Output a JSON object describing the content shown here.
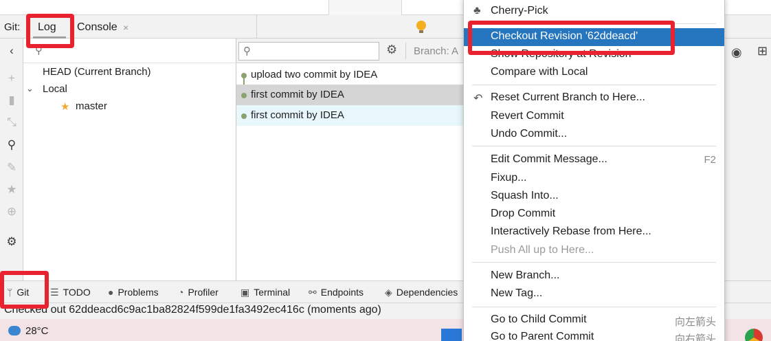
{
  "tool_window": {
    "label": "Git:",
    "tabs": [
      {
        "label": "Log",
        "active": true
      },
      {
        "label": "Console",
        "active": false
      }
    ],
    "close_glyph": "×"
  },
  "branches": {
    "head": "HEAD (Current Branch)",
    "local_label": "Local",
    "master": "master"
  },
  "log": {
    "branch_filter": "Branch: A",
    "commits": [
      {
        "message": "upload two commit by IDEA"
      },
      {
        "message": "first commit by IDEA"
      },
      {
        "message": "first commit by IDEA"
      }
    ]
  },
  "context_menu": {
    "items": [
      {
        "label": "Cherry-Pick",
        "icon": "cherry-icon"
      },
      {
        "label": "Checkout Revision '62ddeacd'",
        "highlighted": true
      },
      {
        "label": "Show Repository at Revision"
      },
      {
        "label": "Compare with Local"
      },
      {
        "label": "Reset Current Branch to Here...",
        "icon": "undo-icon"
      },
      {
        "label": "Revert Commit"
      },
      {
        "label": "Undo Commit..."
      },
      {
        "label": "Edit Commit Message...",
        "shortcut": "F2"
      },
      {
        "label": "Fixup..."
      },
      {
        "label": "Squash Into..."
      },
      {
        "label": "Drop Commit"
      },
      {
        "label": "Interactively Rebase from Here..."
      },
      {
        "label": "Push All up to Here...",
        "disabled": true
      },
      {
        "label": "New Branch..."
      },
      {
        "label": "New Tag..."
      },
      {
        "label": "Go to Child Commit",
        "shortcut": "向左箭头"
      },
      {
        "label": "Go to Parent Commit",
        "shortcut": "向右箭头"
      }
    ]
  },
  "bottom_toolbar": {
    "items": [
      {
        "label": "Git",
        "icon": "git-branch-icon"
      },
      {
        "label": "TODO",
        "icon": "list-icon"
      },
      {
        "label": "Problems",
        "icon": "info-icon"
      },
      {
        "label": "Profiler",
        "icon": "profiler-icon"
      },
      {
        "label": "Terminal",
        "icon": "terminal-icon"
      },
      {
        "label": "Endpoints",
        "icon": "endpoints-icon"
      },
      {
        "label": "Dependencies",
        "icon": "layers-icon"
      }
    ]
  },
  "status": {
    "message": "Checked out 62ddeacd6c9ac1ba82824f599de1fa3492ec416c (moments ago)"
  },
  "taskbar": {
    "temperature": "28°C"
  },
  "colors": {
    "selection_blue": "#2675bf",
    "annotation_red": "#e8232f",
    "graph_green": "#8aa26e",
    "selected_row": "#d5d5d5",
    "hover_row": "#e8f7fb"
  }
}
